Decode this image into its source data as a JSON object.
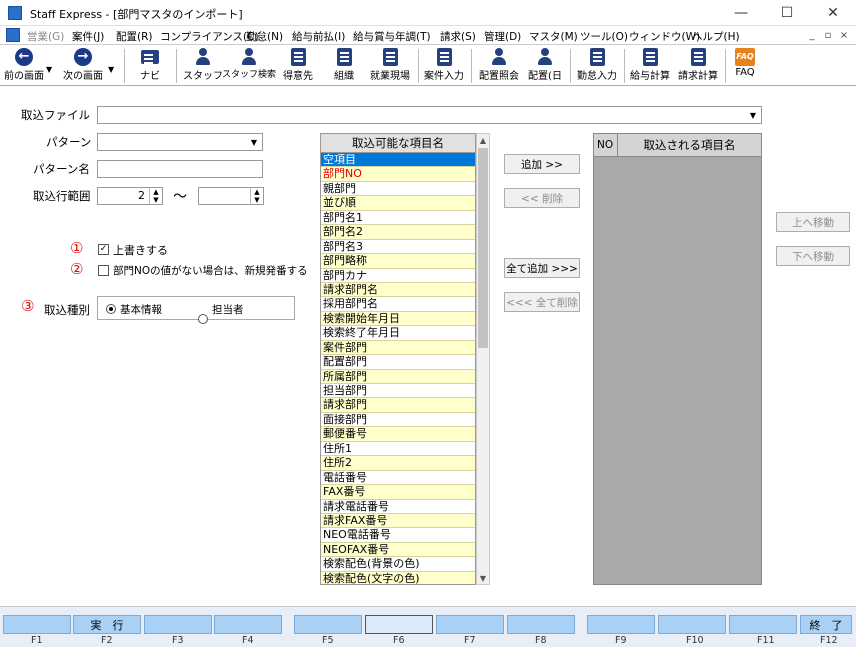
{
  "window": {
    "title": "Staff Express - [部門マスタのインポート]",
    "minimize": "—",
    "maximize": "☐",
    "close": "✕"
  },
  "menu": {
    "items": [
      "営業(G)",
      "案件(J)",
      "配置(R)",
      "コンプライアンス(C)",
      "勤怠(N)",
      "給与前払(I)",
      "給与賞与年調(T)",
      "請求(S)",
      "管理(D)",
      "マスタ(M)",
      "ツール(O)",
      "ウィンドウ(W)",
      "ヘルプ(H)"
    ],
    "mdi_minimize": "_",
    "mdi_restore": "▫",
    "mdi_close": "×"
  },
  "toolbar": {
    "buttons": [
      "前の画面",
      "次の画面",
      "ナビ",
      "スタッフ",
      "スタッフ検索",
      "得意先",
      "組織",
      "就業現場",
      "案件入力",
      "配置照会",
      "配置(日",
      "勤怠入力",
      "給与計算",
      "請求計算",
      "FAQ"
    ]
  },
  "form": {
    "import_file_label": "取込ファイル",
    "import_file_value": "",
    "pattern_label": "パターン",
    "pattern_value": "",
    "pattern_name_label": "パターン名",
    "pattern_name_value": "",
    "range_label": "取込行範囲",
    "range_from": "2",
    "range_tilde": "～",
    "range_to": "",
    "marker1": "①",
    "marker2": "②",
    "marker3": "③",
    "overwrite_label": "上書きする",
    "overwrite_checked": true,
    "newno_label": "部門NOの値がない場合は、新規発番する",
    "newno_checked": false,
    "kind_label": "取込種別",
    "kind_options": [
      "基本情報",
      "担当者"
    ],
    "kind_selected": "基本情報"
  },
  "available": {
    "header": "取込可能な項目名",
    "items": [
      "空項目",
      "部門NO",
      "親部門",
      "並び順",
      "部門名1",
      "部門名2",
      "部門名3",
      "部門略称",
      "部門カナ",
      "請求部門名",
      "採用部門名",
      "検索開始年月日",
      "検索終了年月日",
      "案件部門",
      "配置部門",
      "所属部門",
      "担当部門",
      "請求部門",
      "面接部門",
      "郵便番号",
      "住所1",
      "住所2",
      "電話番号",
      "FAX番号",
      "請求電話番号",
      "請求FAX番号",
      "NEO電話番号",
      "NEOFAX番号",
      "検索配色(背景の色)",
      "検索配色(文字の色)"
    ],
    "selected": "空項目",
    "required": [
      "部門NO"
    ]
  },
  "actions": {
    "add": "追加 >>",
    "remove": "<< 削除",
    "add_all": "全て追加 >>>",
    "remove_all": "<<< 全て削除",
    "move_up": "上へ移動",
    "move_down": "下へ移動"
  },
  "imported": {
    "no_header": "NO",
    "name_header": "取込される項目名"
  },
  "fkeys": [
    {
      "key": "F1",
      "label": ""
    },
    {
      "key": "F2",
      "label": "実　行"
    },
    {
      "key": "F3",
      "label": ""
    },
    {
      "key": "F4",
      "label": ""
    },
    {
      "key": "F5",
      "label": ""
    },
    {
      "key": "F6",
      "label": ""
    },
    {
      "key": "F7",
      "label": ""
    },
    {
      "key": "F8",
      "label": ""
    },
    {
      "key": "F9",
      "label": ""
    },
    {
      "key": "F10",
      "label": ""
    },
    {
      "key": "F11",
      "label": ""
    },
    {
      "key": "F12",
      "label": "終　了"
    }
  ]
}
